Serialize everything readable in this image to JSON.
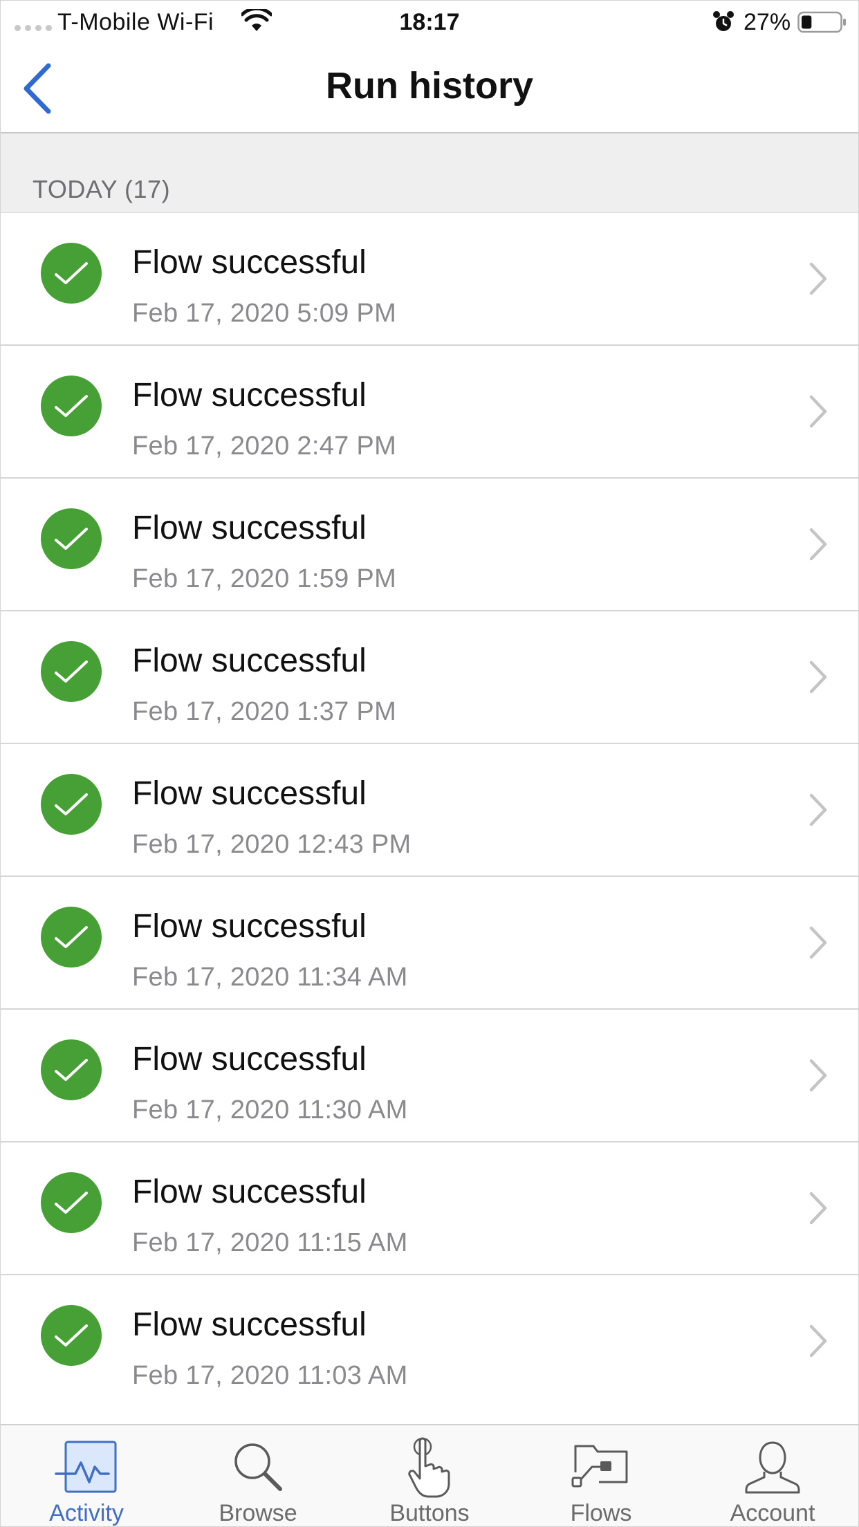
{
  "status_bar": {
    "carrier": "T-Mobile Wi-Fi",
    "time": "18:17",
    "battery_percent": "27%",
    "battery_level": 0.27
  },
  "nav": {
    "title": "Run history",
    "back_icon": "chevron-left-icon"
  },
  "section": {
    "title": "TODAY (17)"
  },
  "runs": [
    {
      "title": "Flow successful",
      "time": "Feb 17, 2020 5:09 PM",
      "status": "success"
    },
    {
      "title": "Flow successful",
      "time": "Feb 17, 2020 2:47 PM",
      "status": "success"
    },
    {
      "title": "Flow successful",
      "time": "Feb 17, 2020 1:59 PM",
      "status": "success"
    },
    {
      "title": "Flow successful",
      "time": "Feb 17, 2020 1:37 PM",
      "status": "success"
    },
    {
      "title": "Flow successful",
      "time": "Feb 17, 2020 12:43 PM",
      "status": "success"
    },
    {
      "title": "Flow successful",
      "time": "Feb 17, 2020 11:34 AM",
      "status": "success"
    },
    {
      "title": "Flow successful",
      "time": "Feb 17, 2020 11:30 AM",
      "status": "success"
    },
    {
      "title": "Flow successful",
      "time": "Feb 17, 2020 11:15 AM",
      "status": "success"
    },
    {
      "title": "Flow successful",
      "time": "Feb 17, 2020 11:03 AM",
      "status": "success"
    }
  ],
  "tabs": [
    {
      "label": "Activity",
      "icon": "activity-icon",
      "active": true
    },
    {
      "label": "Browse",
      "icon": "search-icon",
      "active": false
    },
    {
      "label": "Buttons",
      "icon": "touch-icon",
      "active": false
    },
    {
      "label": "Flows",
      "icon": "flows-folder-icon",
      "active": false
    },
    {
      "label": "Account",
      "icon": "person-icon",
      "active": false
    }
  ],
  "colors": {
    "success": "#46a035",
    "accent": "#3f6fc6",
    "back_arrow": "#2f6ad1"
  }
}
